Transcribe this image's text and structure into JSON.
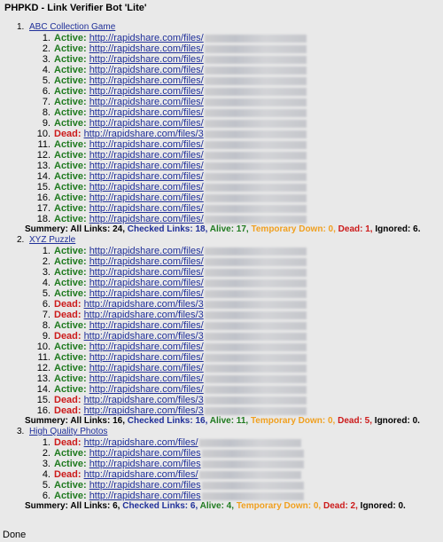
{
  "title": "PHPKD - Link Verifier Bot 'Lite'",
  "status_bar": "Done",
  "groups": [
    {
      "number": "1.",
      "name": "ABC Collection Game",
      "links": [
        {
          "number": "1.",
          "status": "Active:",
          "url": "http://rapidshare.com/files/"
        },
        {
          "number": "2.",
          "status": "Active:",
          "url": "http://rapidshare.com/files/"
        },
        {
          "number": "3.",
          "status": "Active:",
          "url": "http://rapidshare.com/files/"
        },
        {
          "number": "4.",
          "status": "Active:",
          "url": "http://rapidshare.com/files/"
        },
        {
          "number": "5.",
          "status": "Active:",
          "url": "http://rapidshare.com/files/"
        },
        {
          "number": "6.",
          "status": "Active:",
          "url": "http://rapidshare.com/files/"
        },
        {
          "number": "7.",
          "status": "Active:",
          "url": "http://rapidshare.com/files/"
        },
        {
          "number": "8.",
          "status": "Active:",
          "url": "http://rapidshare.com/files/"
        },
        {
          "number": "9.",
          "status": "Active:",
          "url": "http://rapidshare.com/files/"
        },
        {
          "number": "10.",
          "status": "Dead:",
          "url": "http://rapidshare.com/files/3"
        },
        {
          "number": "11.",
          "status": "Active:",
          "url": "http://rapidshare.com/files/"
        },
        {
          "number": "12.",
          "status": "Active:",
          "url": "http://rapidshare.com/files/"
        },
        {
          "number": "13.",
          "status": "Active:",
          "url": "http://rapidshare.com/files/"
        },
        {
          "number": "14.",
          "status": "Active:",
          "url": "http://rapidshare.com/files/"
        },
        {
          "number": "15.",
          "status": "Active:",
          "url": "http://rapidshare.com/files/"
        },
        {
          "number": "16.",
          "status": "Active:",
          "url": "http://rapidshare.com/files/"
        },
        {
          "number": "17.",
          "status": "Active:",
          "url": "http://rapidshare.com/files/"
        },
        {
          "number": "18.",
          "status": "Active:",
          "url": "http://rapidshare.com/files/"
        }
      ],
      "summary": {
        "label": "Summery: All Links: 24,",
        "checked": "Checked Links: 18,",
        "alive": "Alive: 17,",
        "temp": "Temporary Down: 0,",
        "dead": "Dead: 1,",
        "ignored": "Ignored: 6."
      }
    },
    {
      "number": "2.",
      "name": "XYZ Puzzle",
      "links": [
        {
          "number": "1.",
          "status": "Active:",
          "url": "http://rapidshare.com/files/"
        },
        {
          "number": "2.",
          "status": "Active:",
          "url": "http://rapidshare.com/files/"
        },
        {
          "number": "3.",
          "status": "Active:",
          "url": "http://rapidshare.com/files/"
        },
        {
          "number": "4.",
          "status": "Active:",
          "url": "http://rapidshare.com/files/"
        },
        {
          "number": "5.",
          "status": "Active:",
          "url": "http://rapidshare.com/files/"
        },
        {
          "number": "6.",
          "status": "Dead:",
          "url": "http://rapidshare.com/files/3"
        },
        {
          "number": "7.",
          "status": "Dead:",
          "url": "http://rapidshare.com/files/3"
        },
        {
          "number": "8.",
          "status": "Active:",
          "url": "http://rapidshare.com/files/"
        },
        {
          "number": "9.",
          "status": "Dead:",
          "url": "http://rapidshare.com/files/3"
        },
        {
          "number": "10.",
          "status": "Active:",
          "url": "http://rapidshare.com/files/"
        },
        {
          "number": "11.",
          "status": "Active:",
          "url": "http://rapidshare.com/files/"
        },
        {
          "number": "12.",
          "status": "Active:",
          "url": "http://rapidshare.com/files/"
        },
        {
          "number": "13.",
          "status": "Active:",
          "url": "http://rapidshare.com/files/"
        },
        {
          "number": "14.",
          "status": "Active:",
          "url": "http://rapidshare.com/files/"
        },
        {
          "number": "15.",
          "status": "Dead:",
          "url": "http://rapidshare.com/files/3"
        },
        {
          "number": "16.",
          "status": "Dead:",
          "url": "http://rapidshare.com/files/3"
        }
      ],
      "summary": {
        "label": "Summery: All Links: 16,",
        "checked": "Checked Links: 16,",
        "alive": "Alive: 11,",
        "temp": "Temporary Down: 0,",
        "dead": "Dead: 5,",
        "ignored": "Ignored: 0."
      }
    },
    {
      "number": "3.",
      "name": "High Quality Photos",
      "links": [
        {
          "number": "1.",
          "status": "Dead:",
          "url": "http://rapidshare.com/files/"
        },
        {
          "number": "2.",
          "status": "Active:",
          "url": "http://rapidshare.com/files"
        },
        {
          "number": "3.",
          "status": "Active:",
          "url": "http://rapidshare.com/files"
        },
        {
          "number": "4.",
          "status": "Dead:",
          "url": "http://rapidshare.com/files/"
        },
        {
          "number": "5.",
          "status": "Active:",
          "url": "http://rapidshare.com/files"
        },
        {
          "number": "6.",
          "status": "Active:",
          "url": "http://rapidshare.com/files"
        }
      ],
      "summary": {
        "label": "Summery: All Links: 6,",
        "checked": "Checked Links: 6,",
        "alive": "Alive: 4,",
        "temp": "Temporary Down: 0,",
        "dead": "Dead: 2,",
        "ignored": "Ignored: 0."
      }
    }
  ]
}
